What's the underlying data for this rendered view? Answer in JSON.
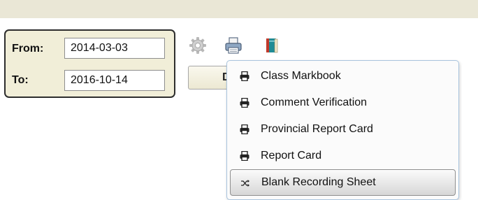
{
  "date_range": {
    "from_label": "From:",
    "from_value": "2014-03-03",
    "to_label": "To:",
    "to_value": "2016-10-14"
  },
  "toolbar": {
    "icons": [
      "gear-icon",
      "printer-icon",
      "book-icon"
    ],
    "hidden_button_label": "D"
  },
  "print_menu": {
    "items": [
      {
        "label": "Class Markbook",
        "icon": "printer-icon"
      },
      {
        "label": "Comment Verification",
        "icon": "printer-icon"
      },
      {
        "label": "Provincial Report Card",
        "icon": "printer-icon"
      },
      {
        "label": "Report Card",
        "icon": "printer-icon"
      },
      {
        "label": "Blank Recording Sheet",
        "icon": "shuffle-icon",
        "highlighted": true
      }
    ]
  },
  "colors": {
    "top_bar": "#eae7d6",
    "panel_background": "#f1eed8",
    "panel_border": "#2d2d2d",
    "menu_border": "#a9c4de",
    "book_accent": "#1f8b95"
  }
}
